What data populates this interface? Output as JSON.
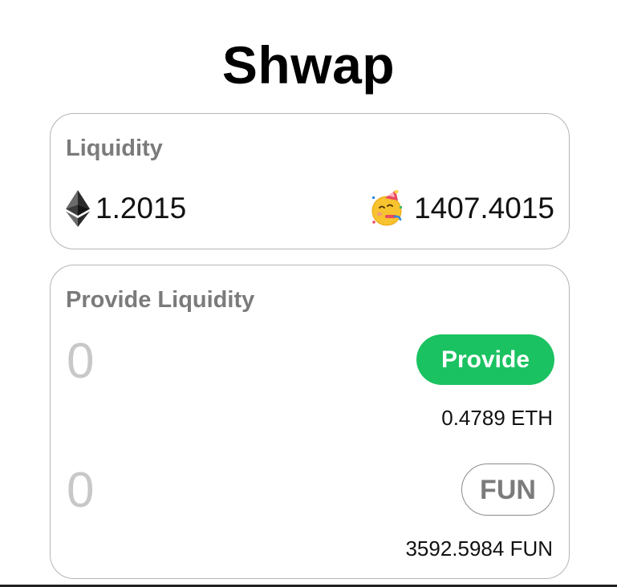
{
  "app": {
    "title": "Shwap"
  },
  "liquidity": {
    "title": "Liquidity",
    "eth_amount": "1.2015",
    "eth_icon": "ethereum-icon",
    "token_amount": "1407.4015",
    "token_icon": "partying-face-emoji-icon"
  },
  "provide": {
    "title": "Provide Liquidity",
    "eth_input": {
      "value": "",
      "placeholder": "0"
    },
    "provide_label": "Provide",
    "eth_balance": "0.4789 ETH",
    "token_input": {
      "value": "",
      "placeholder": "0"
    },
    "token_label": "FUN",
    "token_balance": "3592.5984 FUN"
  },
  "colors": {
    "accent_green": "#1bc261",
    "muted_text": "#7b7b7b",
    "card_border": "#b5b5b5",
    "placeholder": "#c8c8c8"
  }
}
